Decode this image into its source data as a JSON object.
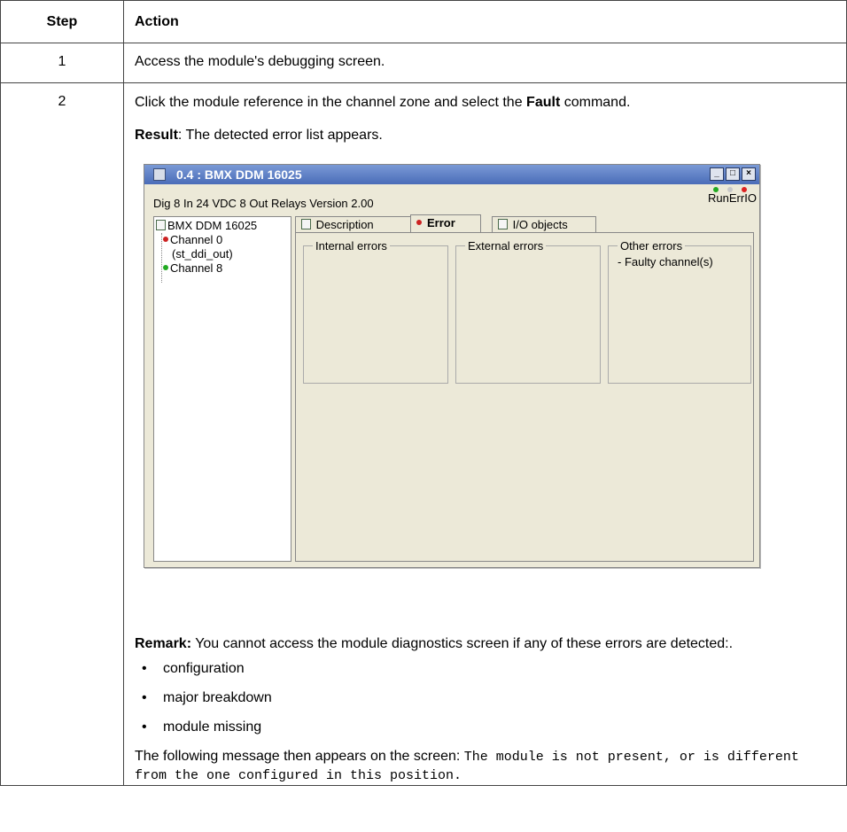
{
  "table": {
    "header": {
      "step": "Step",
      "action": "Action"
    },
    "row1": {
      "step": "1",
      "text": "Access the module's debugging screen."
    },
    "row2": {
      "step": "2",
      "instruction_pre": "Click the module reference in the channel zone and select the ",
      "instruction_bold": "Fault",
      "instruction_post": " command.",
      "result_label": "Result",
      "result_text": ": The detected error list appears.",
      "remark_label": "Remark:",
      "remark_text": " You cannot access the module diagnostics screen if any of these errors are detected:.",
      "bullets": [
        "configuration",
        "major breakdown",
        "module missing"
      ],
      "message_pre": "The following message then appears on the screen: ",
      "message_code": "The module is not present, or is different from the one configured in this position."
    }
  },
  "window": {
    "title": "0.4 : BMX DDM 16025",
    "subtitle": "Dig 8 In 24 VDC 8 Out Relays Version 2.00",
    "leds": [
      {
        "label": "Run",
        "color": "#22aa22"
      },
      {
        "label": "Err",
        "color": "#c8c8c8"
      },
      {
        "label": "IO",
        "color": "#dd2222"
      }
    ],
    "tree": {
      "root": "BMX DDM 16025",
      "channel0": "Channel 0",
      "channel0_sub": "(st_ddi_out)",
      "channel8": "Channel 8",
      "channel0_color": "#cc2222",
      "channel8_color": "#22aa22"
    },
    "tabs": [
      "Description",
      "Error",
      "I/O objects"
    ],
    "error_dot_color": "#cc2222",
    "groups": {
      "internal": "Internal errors",
      "external": "External errors",
      "other": "Other errors",
      "other_value": "- Faulty channel(s)"
    }
  }
}
